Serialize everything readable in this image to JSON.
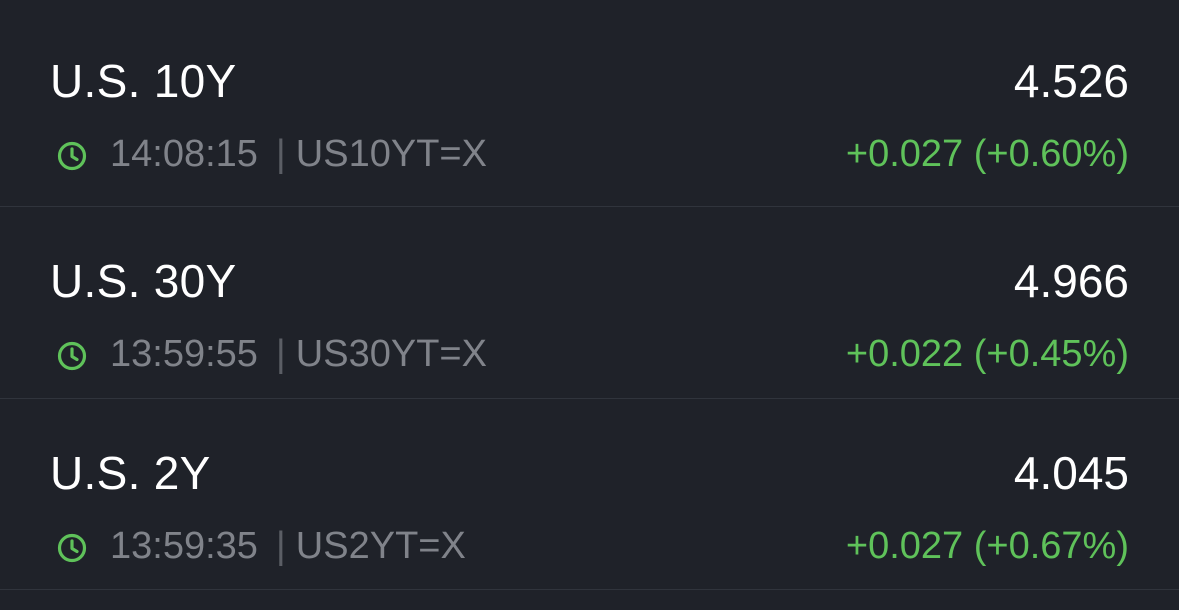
{
  "colors": {
    "background": "#1f2229",
    "primary_text": "#ffffff",
    "secondary_text": "#80838a",
    "positive": "#5fc25a",
    "divider": "#30343c"
  },
  "quotes": [
    {
      "name": "U.S. 10Y",
      "price": "4.526",
      "time": "14:08:15",
      "separator": "|",
      "symbol": "US10YT=X",
      "change": "+0.027 (+0.60%)",
      "icon": "clock-icon"
    },
    {
      "name": "U.S. 30Y",
      "price": "4.966",
      "time": "13:59:55",
      "separator": "|",
      "symbol": "US30YT=X",
      "change": "+0.022 (+0.45%)",
      "icon": "clock-icon"
    },
    {
      "name": "U.S. 2Y",
      "price": "4.045",
      "time": "13:59:35",
      "separator": "|",
      "symbol": "US2YT=X",
      "change": "+0.027 (+0.67%)",
      "icon": "clock-icon"
    }
  ]
}
